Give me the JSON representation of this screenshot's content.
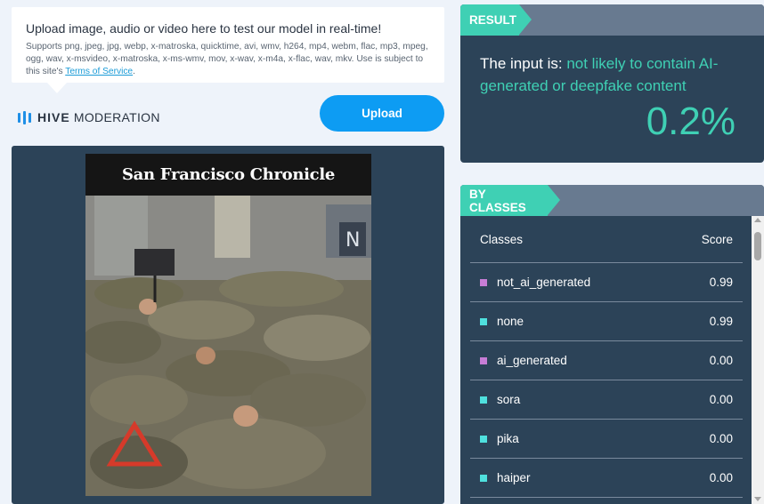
{
  "upload_info": {
    "title": "Upload image, audio or video here to test our model in real-time!",
    "description": "Supports png, jpeg, jpg, webp, x-matroska, quicktime, avi, wmv, h264, mp4, webm, flac, mp3, mpeg, ogg, wav, x-msvideo, x-matroska, x-ms-wmv, mov, x-wav, x-m4a, x-flac, wav, mkv. Use is subject to this site's ",
    "terms_link": "Terms of Service",
    "terms_suffix": "."
  },
  "logo": {
    "brand": "HIVE",
    "product": "MODERATION"
  },
  "upload_button": {
    "label": "Upload"
  },
  "preview": {
    "newspaper_masthead": "San Francisco Chronicle"
  },
  "result": {
    "tab_label": "RESULT",
    "prefix": "The input is: ",
    "verdict": "not likely to contain AI-generated or deepfake content",
    "percentage": "0.2%"
  },
  "classes": {
    "tab_label": "BY CLASSES",
    "header_class": "Classes",
    "header_score": "Score",
    "rows": [
      {
        "name": "not_ai_generated",
        "score": "0.99",
        "color": "#c77dd6"
      },
      {
        "name": "none",
        "score": "0.99",
        "color": "#4fe0de"
      },
      {
        "name": "ai_generated",
        "score": "0.00",
        "color": "#c77dd6"
      },
      {
        "name": "sora",
        "score": "0.00",
        "color": "#4fe0de"
      },
      {
        "name": "pika",
        "score": "0.00",
        "color": "#4fe0de"
      },
      {
        "name": "haiper",
        "score": "0.00",
        "color": "#4fe0de"
      }
    ]
  },
  "colors": {
    "accent": "#3fd0b4",
    "panel": "#2c4358",
    "button": "#0d9cf3"
  }
}
